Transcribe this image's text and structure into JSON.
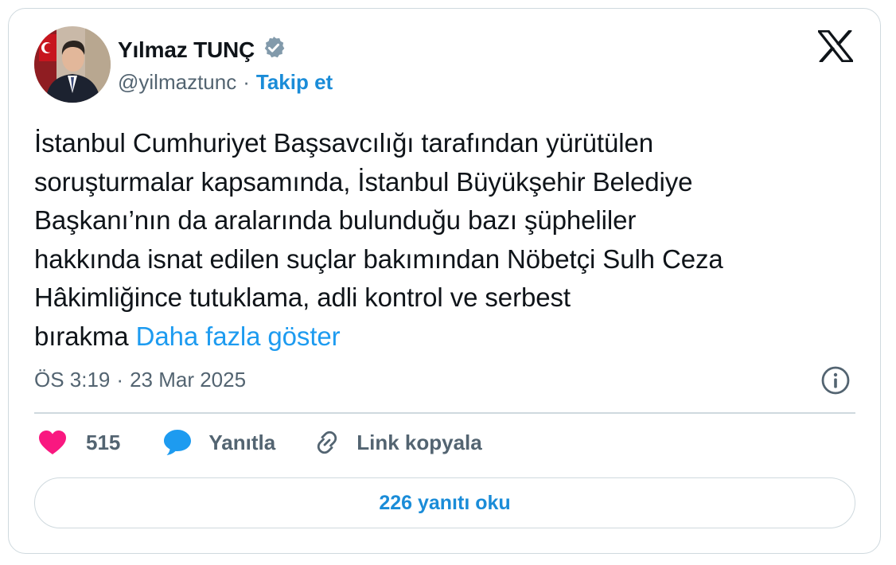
{
  "author": {
    "name": "Yılmaz TUNÇ",
    "handle": "@yilmaztunc",
    "separator": "·",
    "follow_label": "Takip et",
    "verified_badge_icon": "verified-badge-icon",
    "avatar_icon": "profile-photo"
  },
  "platform_logo_icon": "x-logo-icon",
  "tweet": {
    "lines": [
      "İstanbul Cumhuriyet Başsavcılığı tarafından yürütülen",
      "soruşturmalar kapsamında, İstanbul Büyükşehir Belediye",
      "Başkanı’nın da aralarında bulunduğu bazı şüpheliler",
      "hakkında isnat edilen suçlar bakımından Nöbetçi Sulh Ceza",
      "Hâkimliğince tutuklama, adli kontrol ve serbest"
    ],
    "last_line": "bırakma",
    "show_more_label": "Daha fazla göster"
  },
  "meta": {
    "time": "ÖS 3:19",
    "separator": "·",
    "date": "23 Mar 2025",
    "info_icon": "info-icon"
  },
  "actions": {
    "like_icon": "heart-icon",
    "like_count": "515",
    "reply_icon": "speech-bubble-icon",
    "reply_label": "Yanıtla",
    "copy_icon": "link-icon",
    "copy_label": "Link kopyala"
  },
  "read_replies_label": "226 yanıtı oku",
  "colors": {
    "accent": "#1d9bf0",
    "accent_dark": "#1a8cd8",
    "like": "#f91880",
    "muted": "#536471",
    "border": "#cfd9de",
    "text": "#0f1419"
  }
}
